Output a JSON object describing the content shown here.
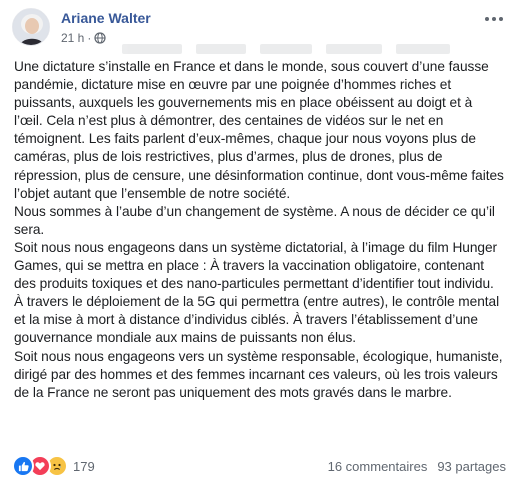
{
  "post": {
    "author": "Ariane Walter",
    "time": "21 h",
    "separator": "·",
    "paragraphs": [
      "Une dictature s’installe en France et dans le monde, sous couvert d’une fausse pandémie, dictature mise en œuvre par une poignée d’hommes riches et puissants, auxquels les gouvernements mis en place obéissent au doigt et à l’œil. Cela n’est plus à démontrer, des centaines de vidéos sur le net en témoignent. Les faits parlent d’eux-mêmes, chaque jour nous voyons plus de caméras, plus de lois restrictives, plus d’armes, plus de drones, plus de répression, plus de censure, une désinformation continue, dont vous-même faites l’objet autant que l’ensemble de notre société.",
      "Nous sommes à l’aube d’un changement de système. A nous de décider ce qu’il sera.",
      "Soit nous nous engageons dans un système dictatorial, à l’image du film Hunger Games, qui se mettra en place : À travers la vaccination obligatoire, contenant des produits toxiques et des nano-particules permettant d’identifier tout individu. À travers le déploiement de la 5G qui permettra (entre autres), le contrôle mental et la mise à mort à distance d’individus ciblés. À travers l’établissement d’une gouvernance mondiale aux mains de puissants non élus.",
      "Soit nous nous engageons vers un système responsable, écologique, humaniste, dirigé par des hommes et des femmes incarnant ces valeurs, où les trois valeurs de la France ne seront pas uniquement des mots gravés dans le marbre."
    ]
  },
  "footer": {
    "reaction_count": "179",
    "reactions": [
      "like-icon",
      "love-icon",
      "sad-icon"
    ],
    "comments": "16 commentaires",
    "shares": "93 partages"
  },
  "colors": {
    "author": "#385898",
    "secondary_text": "#606770",
    "like": "#1877f2",
    "love": "#f33e58",
    "sad": "#f7c344"
  }
}
